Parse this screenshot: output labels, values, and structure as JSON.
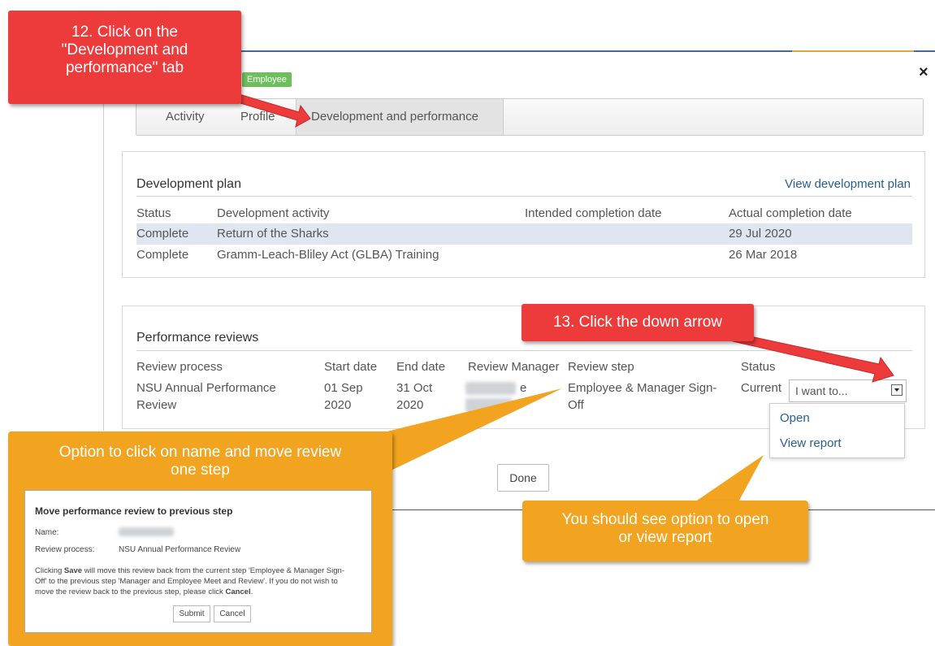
{
  "header": {
    "badge": "Employee",
    "close_glyph": "×"
  },
  "tabs": [
    {
      "label": "Activity"
    },
    {
      "label": "Profile"
    },
    {
      "label": "Development and performance"
    }
  ],
  "development_plan": {
    "title": "Development plan",
    "view_link": "View development plan",
    "columns": [
      "Status",
      "Development activity",
      "Intended completion date",
      "Actual completion date"
    ],
    "rows": [
      {
        "status": "Complete",
        "activity": "Return of the Sharks",
        "intended": "",
        "actual": "29 Jul 2020"
      },
      {
        "status": "Complete",
        "activity": "Gramm-Leach-Bliley Act (GLBA) Training",
        "intended": "",
        "actual": "26 Mar 2018"
      }
    ]
  },
  "performance_reviews": {
    "title": "Performance reviews",
    "columns": [
      "Review process",
      "Start date",
      "End date",
      "Review Manager",
      "Review step",
      "Status"
    ],
    "row": {
      "process_line1": "NSU Annual Performance",
      "process_line2": "Review",
      "start_line1": "01 Sep",
      "start_line2": "2020",
      "end_line1": "31 Oct",
      "end_line2": "2020",
      "manager_suffix": "e",
      "step_line1": "Employee & Manager Sign-",
      "step_line2": "Off",
      "status": "Current"
    },
    "select_value": "I want to...",
    "dropdown": [
      "Open",
      "View report"
    ]
  },
  "done_label": "Done",
  "callouts": {
    "c12_line1": "12. Click on the",
    "c12_line2": "\"Development and",
    "c12_line3": "performance\" tab",
    "c13": "13. Click the down arrow",
    "option_line1": "Option to click on name and move review",
    "option_line2": "one step",
    "see_line1": "You should see option to open",
    "see_line2": "or view report"
  },
  "inset": {
    "title": "Move performance review to previous step",
    "name_label": "Name:",
    "process_label": "Review process:",
    "process_value": "NSU Annual Performance Review",
    "msg_line1_a": "Clicking ",
    "msg_save": "Save",
    "msg_line1_b": " will move this review back from the current step 'Employee & Manager Sign-",
    "msg_line2": "Off' to the previous step 'Manager and Employee Meet and Review'. If you do not wish to",
    "msg_line3_a": "move the review back to the previous step, please click ",
    "msg_cancel": "Cancel",
    "msg_line3_b": ".",
    "submit": "Submit",
    "cancel": "Cancel"
  },
  "colors": {
    "red_callout": "#ed3b3b",
    "orange_callout": "#f2a31f",
    "link": "#2a5f8f",
    "badge": "#6cbf5c"
  }
}
